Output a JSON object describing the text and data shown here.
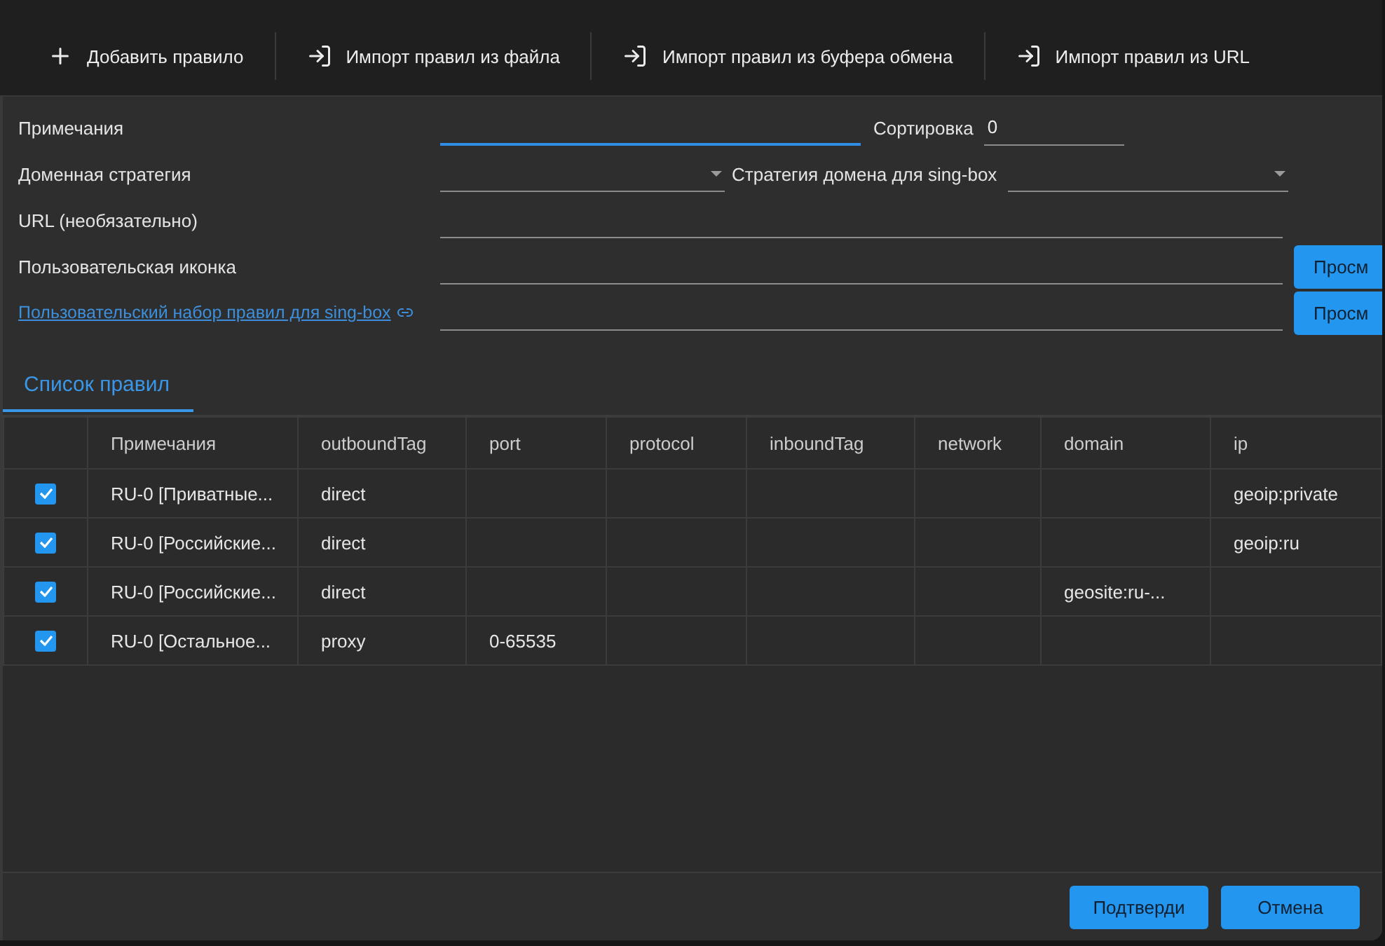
{
  "toolbar": {
    "buttons": [
      {
        "kind": "add",
        "label": "Добавить правило"
      },
      {
        "kind": "import",
        "label": "Импорт правил из файла"
      },
      {
        "kind": "import",
        "label": "Импорт правил из буфера обмена"
      },
      {
        "kind": "import",
        "label": "Импорт правил из URL"
      }
    ]
  },
  "form": {
    "remarks": {
      "label": "Примечания",
      "focused": true
    },
    "sort": {
      "label": "Сортировка",
      "value": "0"
    },
    "domain_strategy": {
      "label": "Доменная стратегия"
    },
    "singbox_domain_strategy": {
      "label": "Стратегия домена для sing-box"
    },
    "url": {
      "label": "URL (необязательно)"
    },
    "custom_icon": {
      "label": "Пользовательская иконка",
      "button": "Просм"
    },
    "singbox_ruleset": {
      "label": "Пользовательский набор правил для sing-box",
      "button": "Просм"
    }
  },
  "tabs": [
    {
      "label": "Список правил",
      "selected": true
    }
  ],
  "table": {
    "columns": [
      "Примечания",
      "outboundTag",
      "port",
      "protocol",
      "inboundTag",
      "network",
      "domain",
      "ip"
    ],
    "rows": [
      {
        "checked": true,
        "cells": [
          "RU-0 [Приватные...",
          "direct",
          null,
          null,
          null,
          null,
          null,
          "geoip:private"
        ]
      },
      {
        "checked": true,
        "cells": [
          "RU-0 [Российские...",
          "direct",
          null,
          null,
          null,
          null,
          null,
          "geoip:ru"
        ]
      },
      {
        "checked": true,
        "cells": [
          "RU-0 [Российские...",
          "direct",
          null,
          null,
          null,
          null,
          "geosite:ru-...",
          null
        ]
      },
      {
        "checked": true,
        "cells": [
          "RU-0 [Остальное...",
          "proxy",
          "0-65535",
          null,
          null,
          null,
          null,
          null
        ]
      }
    ]
  },
  "footer": {
    "buttons": [
      "Подтверди",
      "Отмена"
    ]
  }
}
